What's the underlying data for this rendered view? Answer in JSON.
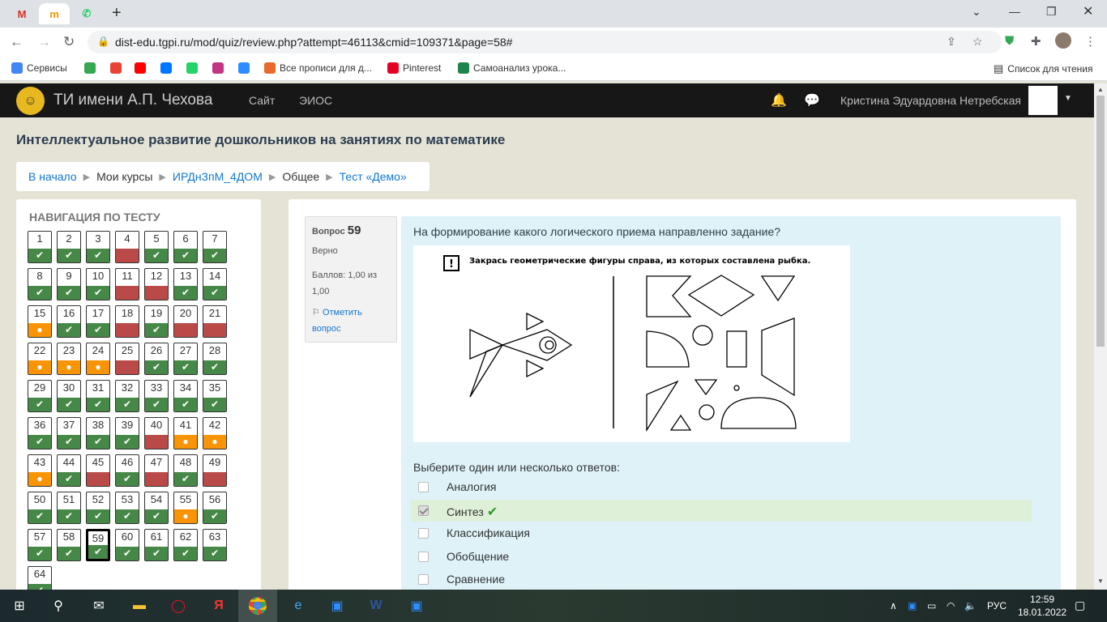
{
  "browser": {
    "tabs": [
      {
        "label": "M",
        "color": "#d93025"
      },
      {
        "label": "m",
        "color": "#f29900"
      },
      {
        "label": "✆",
        "color": "#25d366"
      }
    ],
    "url": "dist-edu.tgpi.ru/mod/quiz/review.php?attempt=46113&cmid=109371&page=58#",
    "bookmarks": [
      {
        "label": "Сервисы",
        "color": "#4285f4"
      },
      {
        "label": "",
        "color": "#34a853"
      },
      {
        "label": "",
        "color": "#ea4335"
      },
      {
        "label": "",
        "color": "#ff0000"
      },
      {
        "label": "",
        "color": "#0077ff"
      },
      {
        "label": "",
        "color": "#25d366"
      },
      {
        "label": "",
        "color": "#c13584"
      },
      {
        "label": "",
        "color": "#2d8cff"
      },
      {
        "label": "Все прописи для д...",
        "color": "#e86a2c"
      },
      {
        "label": "Pinterest",
        "color": "#e60023"
      },
      {
        "label": "Самоанализ урока...",
        "color": "#1e8449"
      }
    ],
    "reading_list": "Список для чтения"
  },
  "site": {
    "brand": "ТИ имени А.П. Чехова",
    "nav": [
      "Сайт",
      "ЭИОС"
    ],
    "user": "Кристина Эдуардовна Нетребская"
  },
  "course_title": "Интеллектуальное развитие дошкольников на занятиях по математике",
  "breadcrumb": [
    "В начало",
    "Мои курсы",
    "ИРДнЗпМ_4ДОМ",
    "Общее",
    "Тест «Демо»"
  ],
  "quiz_nav": {
    "title": "НАВИГАЦИЯ ПО ТЕСТУ",
    "current": 59,
    "states": "cccwccccccwwccpccwcwwpppwccccccccccccccwpppcwcwcwcccccpccccccccc"
  },
  "question": {
    "label": "Вопрос",
    "number": "59",
    "state": "Верно",
    "grade": "Баллов: 1,00 из 1,00",
    "flag": "Отметить вопрос",
    "prompt": "На формирование какого логического приема направленно задание?",
    "image_caption": "Закрась геометрические фигуры справа, из которых составлена рыбка.",
    "select_text": "Выберите один или несколько ответов:",
    "answers": [
      {
        "label": "Аналогия",
        "checked": false
      },
      {
        "label": "Синтез",
        "checked": true
      },
      {
        "label": "Классификация",
        "checked": false
      },
      {
        "label": "Обобщение",
        "checked": false
      },
      {
        "label": "Сравнение",
        "checked": false
      }
    ]
  },
  "taskbar": {
    "lang": "РУС",
    "time": "12:59",
    "date": "18.01.2022"
  }
}
